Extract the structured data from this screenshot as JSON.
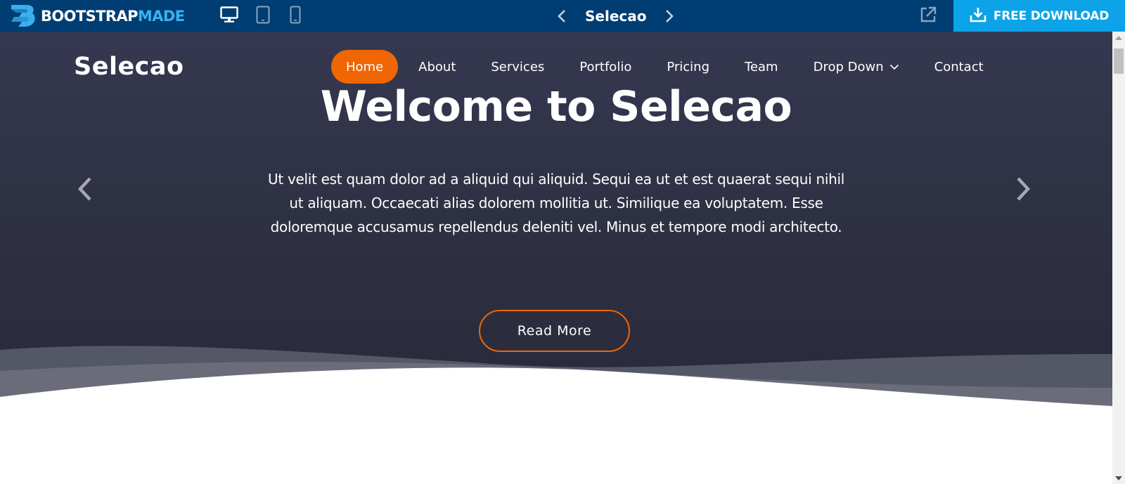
{
  "preview_bar": {
    "brand": {
      "part1": "BOOTSTRAP",
      "part2": "MADE",
      "logo_icon": "bootstrapmade-logo-icon"
    },
    "devices": [
      {
        "name": "desktop",
        "icon": "desktop-icon",
        "active": true
      },
      {
        "name": "tablet",
        "icon": "tablet-icon",
        "active": false
      },
      {
        "name": "mobile",
        "icon": "mobile-icon",
        "active": false
      }
    ],
    "template_title": "Selecao",
    "prev_icon": "chevron-left-icon",
    "next_icon": "chevron-right-icon",
    "open_external_icon": "external-link-icon",
    "download_label": "FREE DOWNLOAD",
    "download_icon": "download-icon"
  },
  "site": {
    "logo": "Selecao",
    "nav": {
      "items": [
        {
          "label": "Home",
          "active": true
        },
        {
          "label": "About"
        },
        {
          "label": "Services"
        },
        {
          "label": "Portfolio"
        },
        {
          "label": "Pricing"
        },
        {
          "label": "Team"
        },
        {
          "label": "Drop Down",
          "has_dropdown": true,
          "icon": "chevron-down-icon"
        },
        {
          "label": "Contact"
        }
      ]
    },
    "hero": {
      "title": "Welcome to Selecao",
      "text": "Ut velit est quam dolor ad a aliquid qui aliquid. Sequi ea ut et est quaerat sequi nihil ut aliquam. Occaecati alias dolorem mollitia ut. Similique ea voluptatem. Esse doloremque accusamus repellendus deleniti vel. Minus et tempore modi architecto.",
      "button_label": "Read More",
      "prev_icon": "carousel-prev-icon",
      "next_icon": "carousel-next-icon"
    }
  },
  "colors": {
    "preview_bar_bg": "#003d73",
    "download_bg": "#0ca3e8",
    "accent": "#ef6603",
    "hero_bg": "#2d2f41",
    "brand_light": "#3bb0ef"
  }
}
